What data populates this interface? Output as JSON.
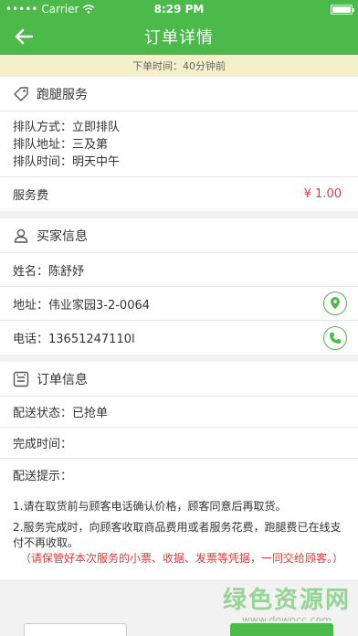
{
  "status_bar": {
    "carrier": "Carrier",
    "time": "8:29 PM"
  },
  "nav": {
    "title": "订单详情",
    "back_icon": "arrow-left-icon"
  },
  "notice": "下单时间：40分钟前",
  "service": {
    "title": "跑腿服务",
    "queue_method": "排队方式：立即排队",
    "queue_address": "排队地址：三及第",
    "queue_time": "排队时间：明天中午",
    "fee_label": "服务费",
    "fee_value": "¥ 1.00"
  },
  "buyer": {
    "title": "买家信息",
    "name": "姓名：陈舒妤",
    "address": "地址：伟业家园3-2-0064",
    "phone": "电话：13651247110l"
  },
  "order": {
    "title": "订单信息",
    "delivery_status": "配送状态：已抢单",
    "complete_time": "完成时间：",
    "tips_label": "配送提示：",
    "tip1": "1.请在取货前与顾客电话确认价格，顾客同意后再取货。",
    "tip2": "2.服务完成时，向顾客收取商品费用或者服务花费，跑腿费已在线支付不再收取。",
    "tip3": "（请保管好本次服务的小票、收据、发票等凭据，一同交给顾客。）"
  },
  "watermark": {
    "big": "绿色资源网",
    "small": "www.downcc.com"
  },
  "colors": {
    "accent": "#4cb94b",
    "price": "#e03b3b",
    "notice_bg": "#f4f0cc"
  }
}
